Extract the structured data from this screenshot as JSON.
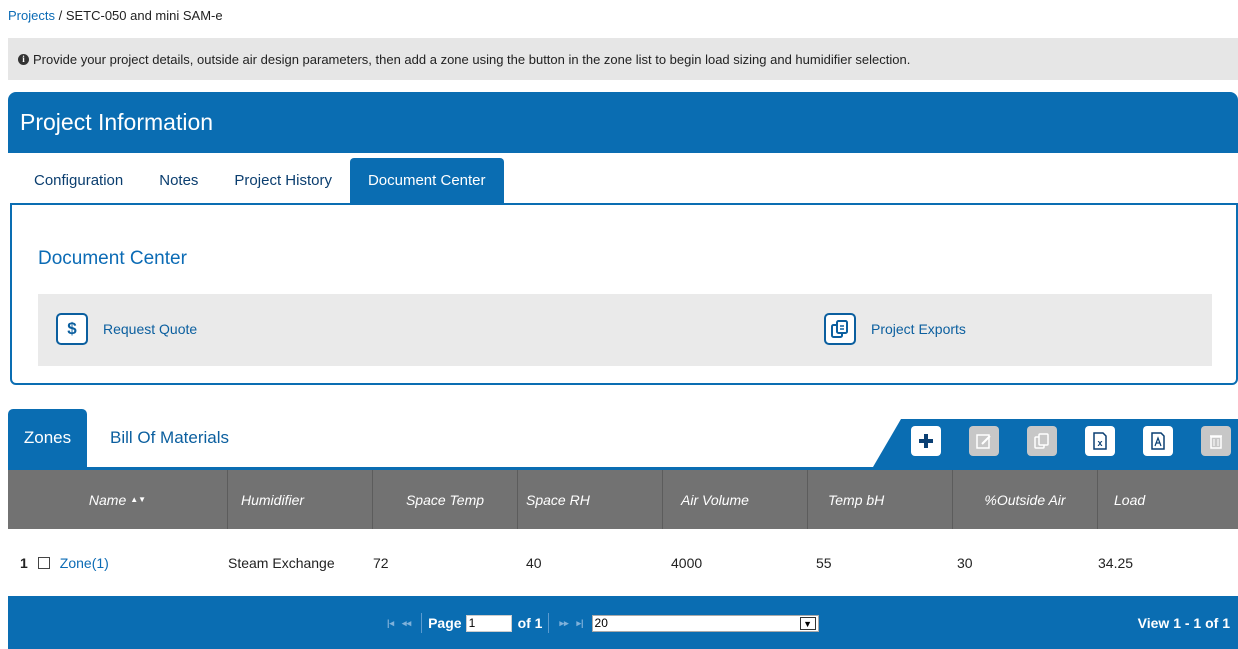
{
  "breadcrumb": {
    "root": "Projects",
    "separator": " / ",
    "current": "SETC-050 and mini SAM-e"
  },
  "info": {
    "text": "Provide your project details, outside air design parameters, then add a zone using the button in the zone list to begin load sizing and humidifier selection."
  },
  "panel": {
    "title": "Project Information"
  },
  "tabs": [
    {
      "label": "Configuration"
    },
    {
      "label": "Notes"
    },
    {
      "label": "Project History"
    },
    {
      "label": "Document Center",
      "active": true
    }
  ],
  "document_center": {
    "title": "Document Center",
    "request_quote": "Request Quote",
    "project_exports": "Project Exports"
  },
  "zone_tabs": {
    "zones": "Zones",
    "bom": "Bill Of Materials"
  },
  "toolbar": {
    "icons": [
      "add-icon",
      "edit-icon",
      "copy-icon",
      "excel-export-icon",
      "pdf-export-icon",
      "delete-icon"
    ]
  },
  "grid": {
    "columns": [
      "Name",
      "Humidifier",
      "Space Temp",
      "Space RH",
      "Air Volume",
      "Temp bH",
      "%Outside Air",
      "Load"
    ],
    "sort_indicator": "▲▼",
    "rows": [
      {
        "num": "1",
        "name": "Zone(1)",
        "humidifier": "Steam Exchange",
        "space_temp": "72",
        "space_rh": "40",
        "air_volume": "4000",
        "temp_bh": "55",
        "outside_air": "30",
        "load": "34.25"
      }
    ]
  },
  "pager": {
    "page_label": "Page",
    "page_value": "1",
    "of_label": "of 1",
    "rows_per_page": "20",
    "view_info": "View 1 - 1 of 1"
  },
  "colors": {
    "primary": "#0a6db2",
    "header_grey": "#727272",
    "link": "#0b6bb5"
  }
}
